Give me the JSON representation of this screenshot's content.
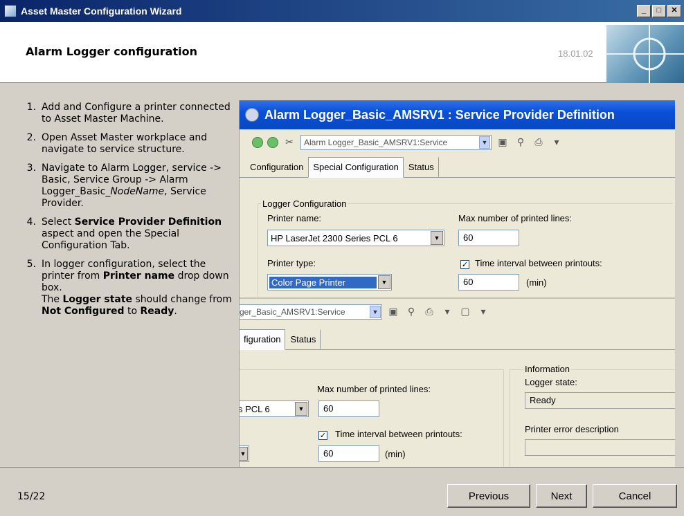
{
  "window": {
    "title": "Asset Master  Configuration Wizard",
    "buttons": [
      "_",
      "□",
      "✕"
    ]
  },
  "header": {
    "title": "Alarm Logger configuration",
    "version": "18.01.02"
  },
  "steps": [
    {
      "num": "1.",
      "text": "Add and Configure a printer connected to Asset Master Machine."
    },
    {
      "num": "2.",
      "text": "Open Asset Master workplace and navigate to service structure."
    },
    {
      "num": "3.",
      "pre": "Navigate to Alarm Logger, service -> Basic, Service Group -> Alarm Logger_Basic_",
      "italic": "NodeName",
      "post": ", Service Provider."
    },
    {
      "num": "4.",
      "pre": "Select ",
      "bold1": "Service Provider Definition",
      "post": " aspect and open the Special Configuration Tab."
    },
    {
      "num": "5.",
      "line1": "In logger configuration, select the printer from ",
      "bold1": "Printer name",
      "line1b": " drop down box.",
      "line2a": "The ",
      "bold2": "Logger state",
      "line2b": " should change from ",
      "bold3": "Not Configured",
      "line2c": " to ",
      "bold4": "Ready",
      "line2d": "."
    }
  ],
  "dialog1": {
    "title": "Alarm Logger_Basic_AMSRV1 : Service Provider Definition",
    "path": "Alarm Logger_Basic_AMSRV1:Service",
    "tabs": [
      "Configuration",
      "Special Configuration",
      "Status"
    ],
    "group": "Logger Configuration",
    "printer_name_label": "Printer name:",
    "printer_name": "HP LaserJet 2300 Series PCL 6",
    "max_lines_label": "Max number of printed lines:",
    "max_lines": "60",
    "printer_type_label": "Printer type:",
    "printer_type": "Color Page Printer",
    "interval_label": "Time interval between printouts:",
    "interval": "60",
    "unit": "(min)"
  },
  "dialog2": {
    "path": "ger_Basic_AMSRV1:Service",
    "tabs": [
      "figuration",
      "Status"
    ],
    "max_lines_label": "Max number of printed lines:",
    "max_lines": "60",
    "printer_partial": "s PCL 6",
    "interval_label": "Time interval between printouts:",
    "interval": "60",
    "unit": "(min)",
    "info_group": "Information",
    "logger_state_label": "Logger state:",
    "logger_state": "Ready",
    "error_label": "Printer error description"
  },
  "footer": {
    "page": "15/22",
    "previous": "Previous",
    "next": "Next",
    "cancel": "Cancel"
  }
}
